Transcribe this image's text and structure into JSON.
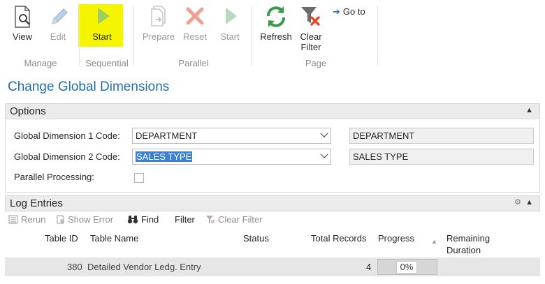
{
  "ribbon": {
    "buttons": [
      {
        "label": "View",
        "state": "enabled"
      },
      {
        "label": "Edit",
        "state": "disabled"
      },
      {
        "label": "Start",
        "state": "highlighted"
      },
      {
        "label": "Prepare",
        "state": "disabled"
      },
      {
        "label": "Reset",
        "state": "disabled"
      },
      {
        "label": "Start",
        "state": "disabled"
      },
      {
        "label": "Refresh",
        "state": "enabled"
      },
      {
        "label": "Clear",
        "label2": "Filter",
        "state": "enabled"
      }
    ],
    "goto": "Go to",
    "groups": [
      "Manage",
      "Sequential",
      "Parallel",
      "Page"
    ]
  },
  "page_title": "Change Global Dimensions",
  "options": {
    "header": "Options",
    "dim1_label": "Global Dimension 1 Code:",
    "dim1_value": "DEPARTMENT",
    "dim1_current": "DEPARTMENT",
    "dim2_label": "Global Dimension 2 Code:",
    "dim2_value": "SALES TYPE",
    "dim2_current": "SALES TYPE",
    "parallel_label": "Parallel Processing:",
    "parallel_checked": false
  },
  "log": {
    "header": "Log Entries",
    "toolbar": [
      "Rerun",
      "Show Error",
      "Find",
      "Filter",
      "Clear Filter"
    ],
    "columns": [
      "Table ID",
      "Table Name",
      "Status",
      "Total Records",
      "Progress",
      "Remaining",
      "Duration"
    ],
    "rows": [
      {
        "table_id": "380",
        "table_name": "Detailed Vendor Ledg. Entry",
        "status": "",
        "total_records": "4",
        "progress": "0%"
      }
    ]
  },
  "colors": {
    "accent": "#1f6fb2",
    "highlight": "#f5f500",
    "selection": "#3b82d7"
  }
}
